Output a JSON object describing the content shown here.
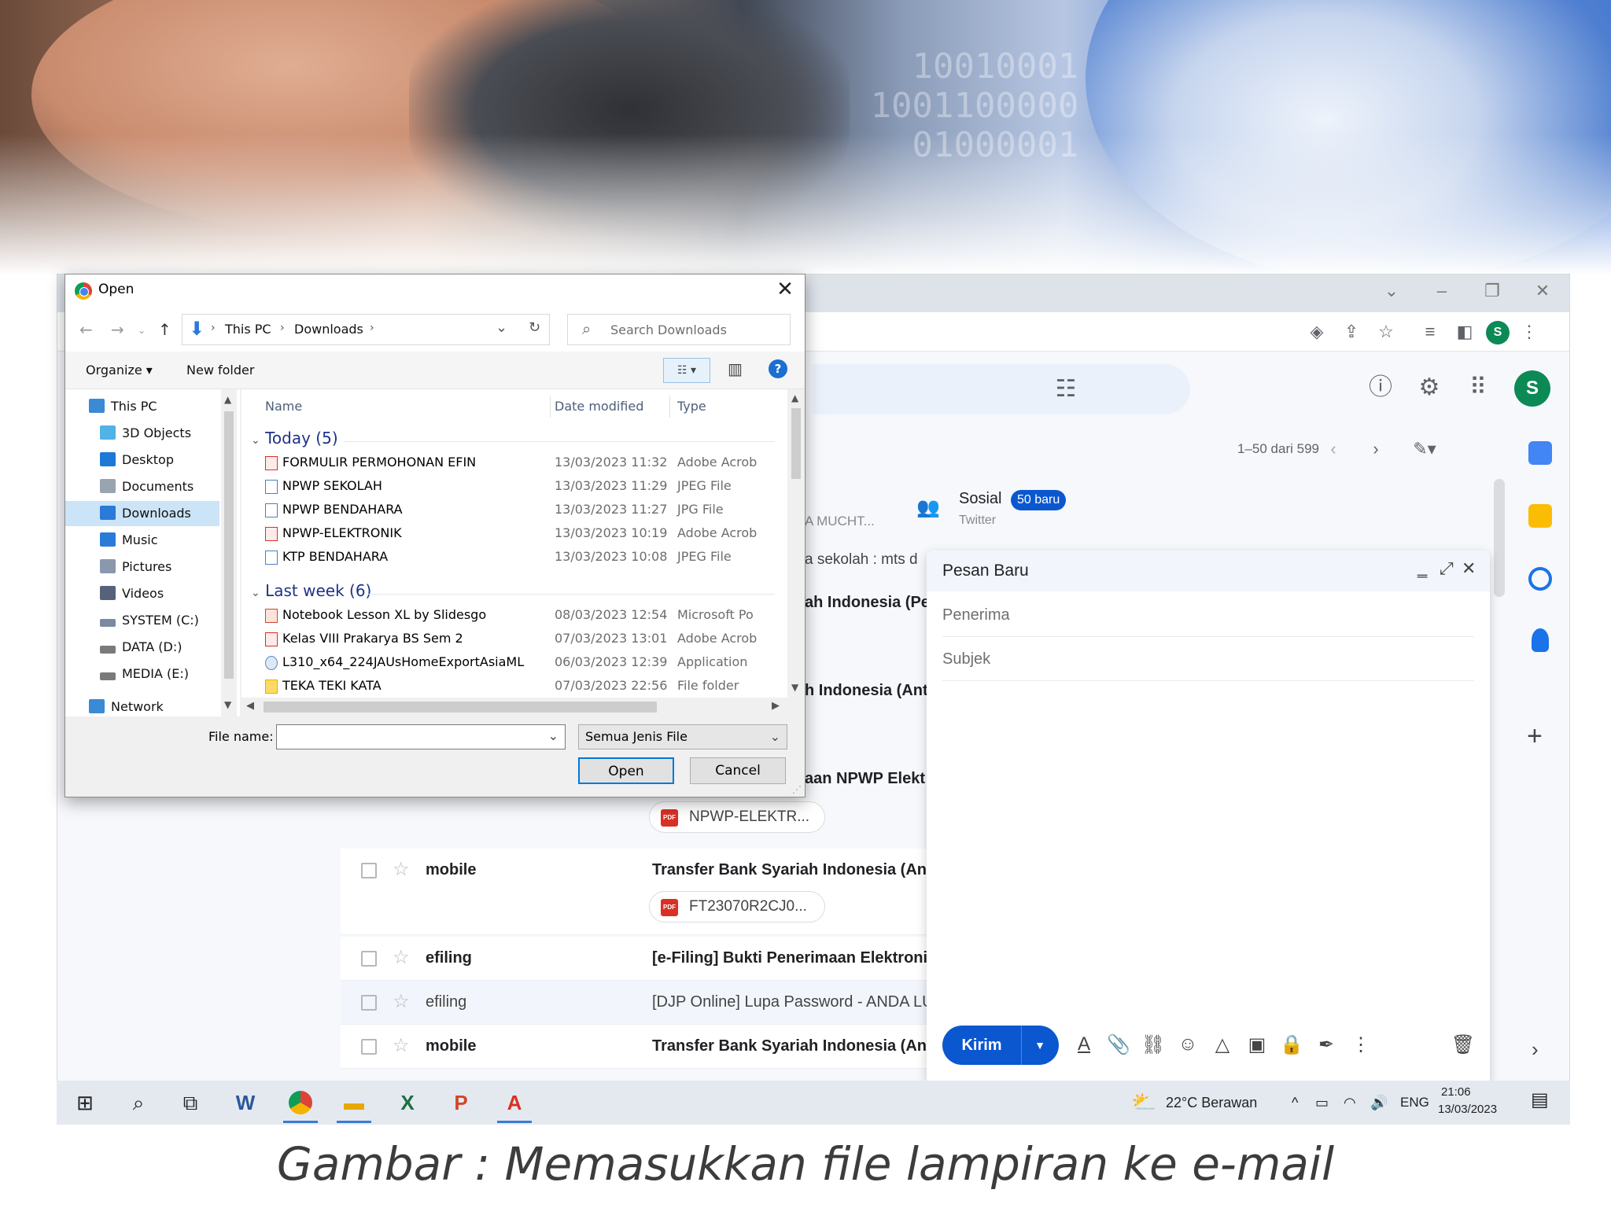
{
  "dialog": {
    "title": "Open",
    "breadcrumb": [
      "This PC",
      "Downloads"
    ],
    "search_placeholder": "Search Downloads",
    "organize": "Organize",
    "new_folder": "New folder",
    "nav_tree": [
      {
        "label": "This PC",
        "icon": "pc-icon",
        "color": "#3a8ad6"
      },
      {
        "label": "3D Objects",
        "icon": "3d-objects-icon",
        "color": "#4fb3e6"
      },
      {
        "label": "Desktop",
        "icon": "desktop-icon",
        "color": "#1e78d6"
      },
      {
        "label": "Documents",
        "icon": "documents-icon",
        "color": "#9aa4b1"
      },
      {
        "label": "Downloads",
        "icon": "downloads-icon",
        "color": "#2a7ad8"
      },
      {
        "label": "Music",
        "icon": "music-icon",
        "color": "#2a7ad8"
      },
      {
        "label": "Pictures",
        "icon": "pictures-icon",
        "color": "#8a98ad"
      },
      {
        "label": "Videos",
        "icon": "videos-icon",
        "color": "#56627a"
      },
      {
        "label": "SYSTEM (C:)",
        "icon": "drive-c-icon",
        "color": "#7a8aa0"
      },
      {
        "label": "DATA (D:)",
        "icon": "drive-icon",
        "color": "#7a7a7a"
      },
      {
        "label": "MEDIA (E:)",
        "icon": "drive-icon",
        "color": "#7a7a7a"
      },
      {
        "label": "Network",
        "icon": "network-icon",
        "color": "#3a8ad6"
      }
    ],
    "columns": {
      "name": "Name",
      "date": "Date modified",
      "type": "Type"
    },
    "groups": [
      {
        "label": "Today (5)",
        "files": [
          {
            "name": "FORMULIR PERMOHONAN EFIN",
            "date": "13/03/2023 11:32",
            "type": "Adobe Acrob",
            "icon": "pdf-icon"
          },
          {
            "name": "NPWP SEKOLAH",
            "date": "13/03/2023 11:29",
            "type": "JPEG File",
            "icon": "image-file-icon"
          },
          {
            "name": "NPWP BENDAHARA",
            "date": "13/03/2023 11:27",
            "type": "JPG File",
            "icon": "image-file-icon"
          },
          {
            "name": "NPWP-ELEKTRONIK",
            "date": "13/03/2023 10:19",
            "type": "Adobe Acrob",
            "icon": "pdf-icon"
          },
          {
            "name": "KTP BENDAHARA",
            "date": "13/03/2023 10:08",
            "type": "JPEG File",
            "icon": "image-file-icon"
          }
        ]
      },
      {
        "label": "Last week (6)",
        "files": [
          {
            "name": "Notebook Lesson XL by Slidesgo",
            "date": "08/03/2023 12:54",
            "type": "Microsoft Po",
            "icon": "pptx-icon"
          },
          {
            "name": "Kelas VIII Prakarya BS Sem 2",
            "date": "07/03/2023 13:01",
            "type": "Adobe Acrob",
            "icon": "pdf-icon"
          },
          {
            "name": "L310_x64_224JAUsHomeExportAsiaML",
            "date": "06/03/2023 12:39",
            "type": "Application",
            "icon": "application-icon"
          },
          {
            "name": "TEKA TEKI KATA",
            "date": "07/03/2023 22:56",
            "type": "File folder",
            "icon": "folder-icon"
          }
        ]
      }
    ],
    "file_name_label": "File name:",
    "file_name_value": "",
    "filter": "Semua Jenis File",
    "open_button": "Open",
    "cancel_button": "Cancel"
  },
  "gmail": {
    "page_count": "1–50 dari 599",
    "social": {
      "title": "Sosial",
      "badge": "50 baru",
      "subtitle": "Twitter"
    },
    "snippets": [
      "A MUCHT...",
      "a sekolah : mts d"
    ],
    "partial_subjects": [
      "ah Indonesia (Pe",
      "h Indonesia (Ant",
      "aan NPWP Elekt"
    ],
    "attachments": [
      "NPWP-ELEKTR...",
      "FT23070R2CJ0..."
    ],
    "rows": [
      {
        "sender": "mobile",
        "subject": "Transfer Bank Syariah Indonesia (Ant",
        "read": false
      },
      {
        "sender": "efiling",
        "subject": "[e-Filing] Bukti Penerimaan Elektroni",
        "read": false
      },
      {
        "sender": "efiling",
        "subject": "[DJP Online] Lupa Password - ANDA LU",
        "read": true
      },
      {
        "sender": "mobile",
        "subject": "Transfer Bank Syariah Indonesia (Ant",
        "read": false
      }
    ],
    "avatar_letter": "S",
    "compose": {
      "title": "Pesan Baru",
      "to_placeholder": "Penerima",
      "subject_placeholder": "Subjek",
      "send_label": "Kirim"
    }
  },
  "taskbar": {
    "weather": "22°C  Berawan",
    "language": "ENG",
    "time": "21:06",
    "date": "13/03/2023"
  },
  "caption": "Gambar : Memasukkan file lampiran ke e-mail"
}
